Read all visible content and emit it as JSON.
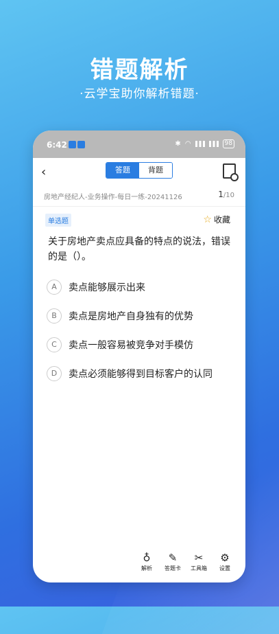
{
  "hero": {
    "title": "错题解析",
    "subtitle": "·云学宝助你解析错题·"
  },
  "status": {
    "time": "6:42",
    "battery": "98"
  },
  "nav": {
    "back": "‹",
    "tabs": [
      {
        "label": "答题",
        "active": true
      },
      {
        "label": "背题",
        "active": false
      }
    ]
  },
  "info": {
    "paper": "房地产经纪人-业务操作-每日一练-20241126",
    "current": "1",
    "total": "/10"
  },
  "question": {
    "type": "单选题",
    "favorite": "收藏",
    "text": "关于房地产卖点应具备的特点的说法，错误的是（）。",
    "options": [
      {
        "letter": "A",
        "text": "卖点能够展示出来"
      },
      {
        "letter": "B",
        "text": "卖点是房地产自身独有的优势"
      },
      {
        "letter": "C",
        "text": "卖点一般容易被竞争对手模仿"
      },
      {
        "letter": "D",
        "text": "卖点必须能够得到目标客户的认同"
      }
    ]
  },
  "tabbar": [
    {
      "label": "解析",
      "icon": "lightbulb-icon"
    },
    {
      "label": "答题卡",
      "icon": "edit-icon"
    },
    {
      "label": "工具箱",
      "icon": "tools-icon"
    },
    {
      "label": "设置",
      "icon": "gear-icon"
    }
  ],
  "colors": {
    "accent": "#2a7de1",
    "star": "#e6a817"
  }
}
